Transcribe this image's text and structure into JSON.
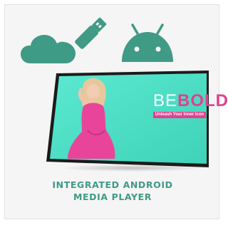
{
  "colors": {
    "accent": "#3f9a86",
    "screen_bg": "#4ee3c9",
    "brand_pink": "#e0418e",
    "bezel": "#1b1b1b"
  },
  "icons": {
    "cloud": "cloud-icon",
    "usb": "usb-drive-icon",
    "android": "android-icon"
  },
  "display": {
    "headline_part1": "BE",
    "headline_part2": "BOLD",
    "tagline": "Unleash Your Inner Icon"
  },
  "caption": {
    "line1": "INTEGRATED ANDROID",
    "line2": "MEDIA PLAYER"
  }
}
